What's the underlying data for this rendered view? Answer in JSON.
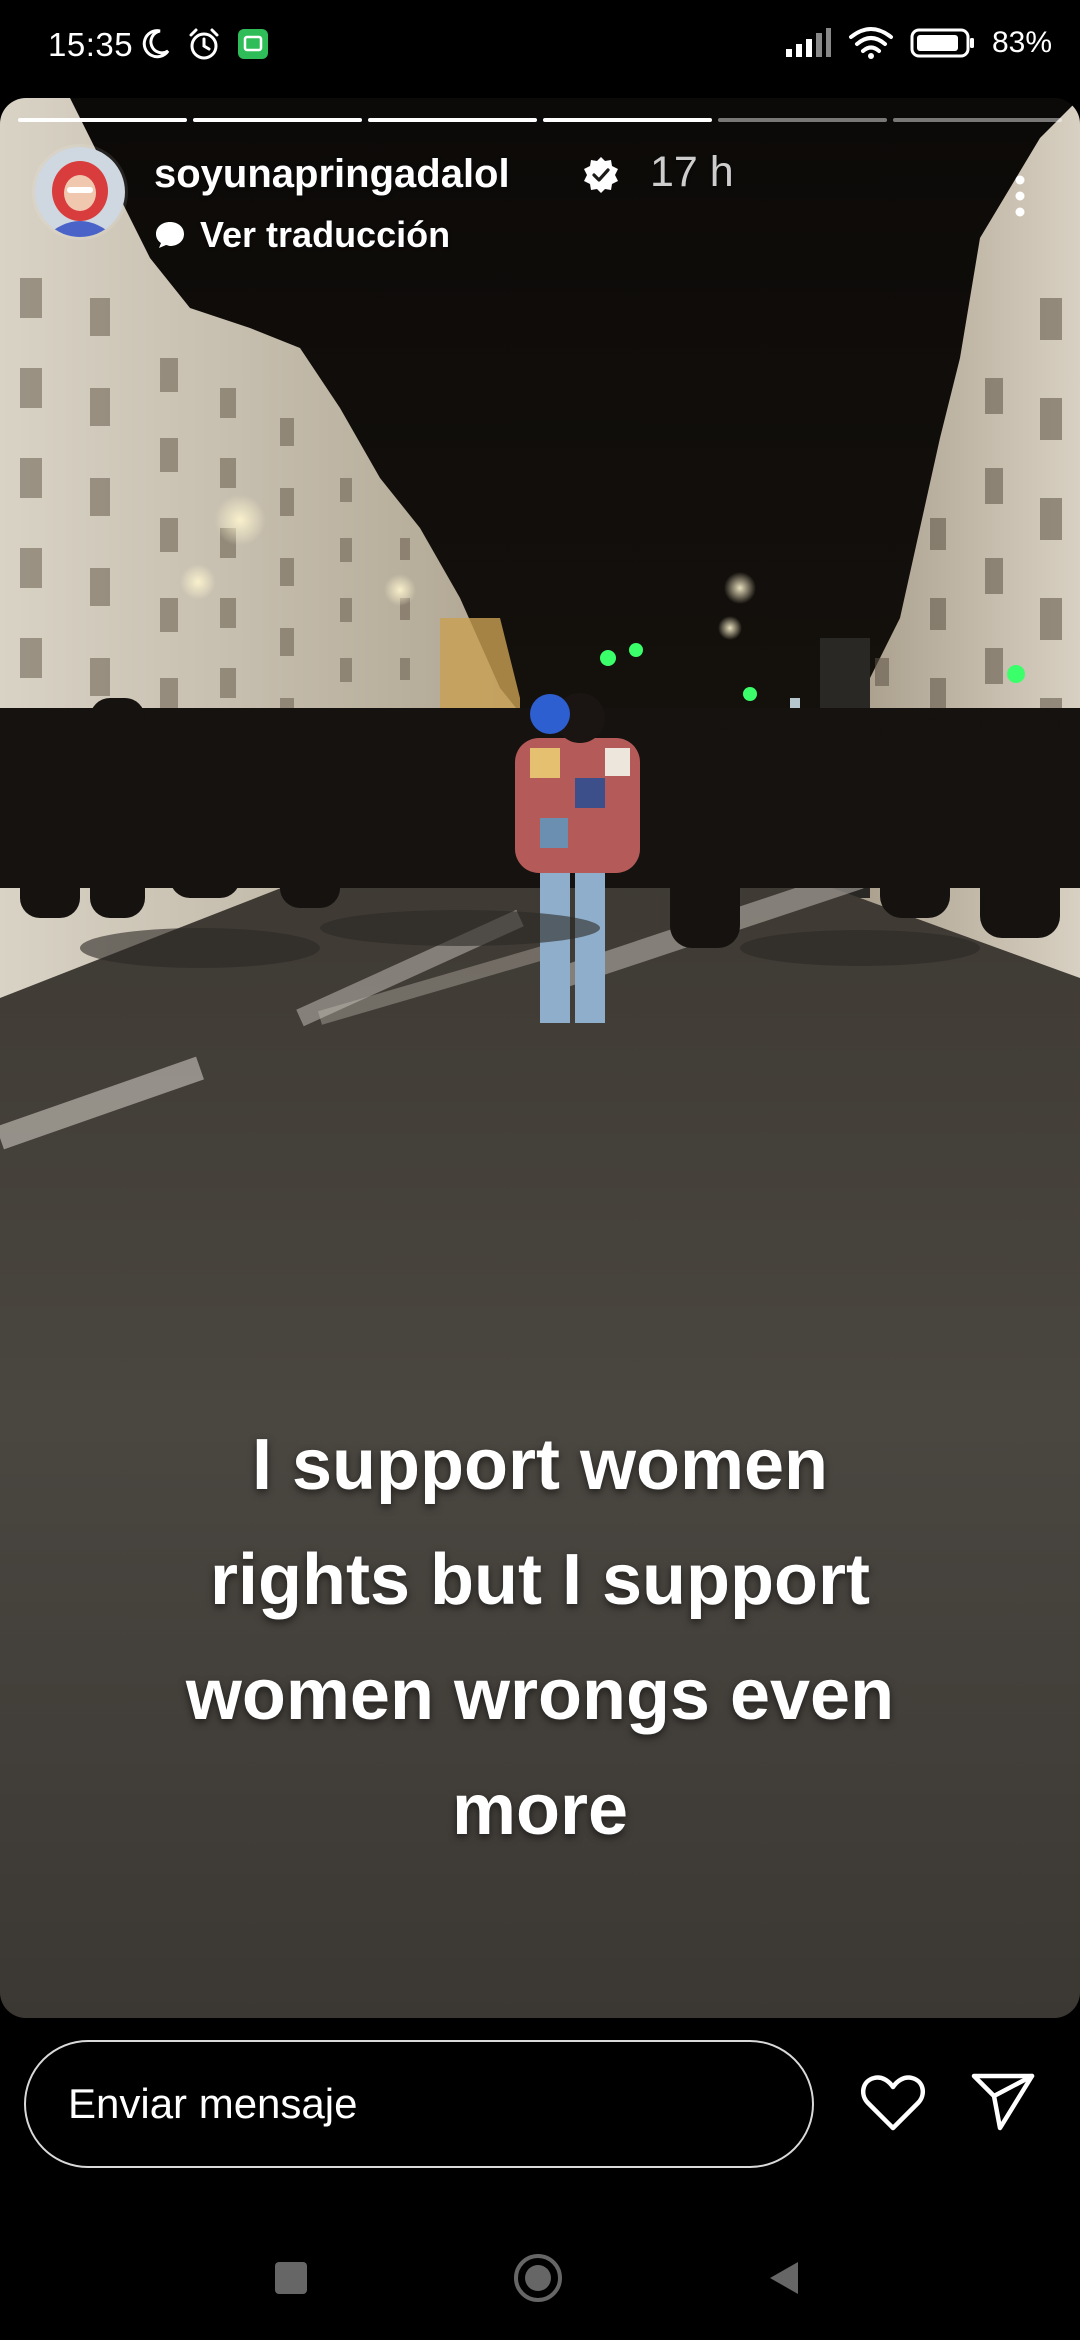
{
  "status_bar": {
    "time": "15:35",
    "battery": "83%"
  },
  "story": {
    "username": "soyunapringadalol",
    "time_ago": "17 h",
    "translate_label": "Ver traducción",
    "caption_lines": [
      "I support women",
      "rights but I support",
      "women wrongs even",
      "more"
    ],
    "progress": {
      "total_segments": 6,
      "completed_segments": 4
    }
  },
  "reply": {
    "placeholder": "Enviar mensaje"
  },
  "colors": {
    "background": "#000000",
    "text": "#ffffff",
    "nav_icon": "#666666"
  }
}
